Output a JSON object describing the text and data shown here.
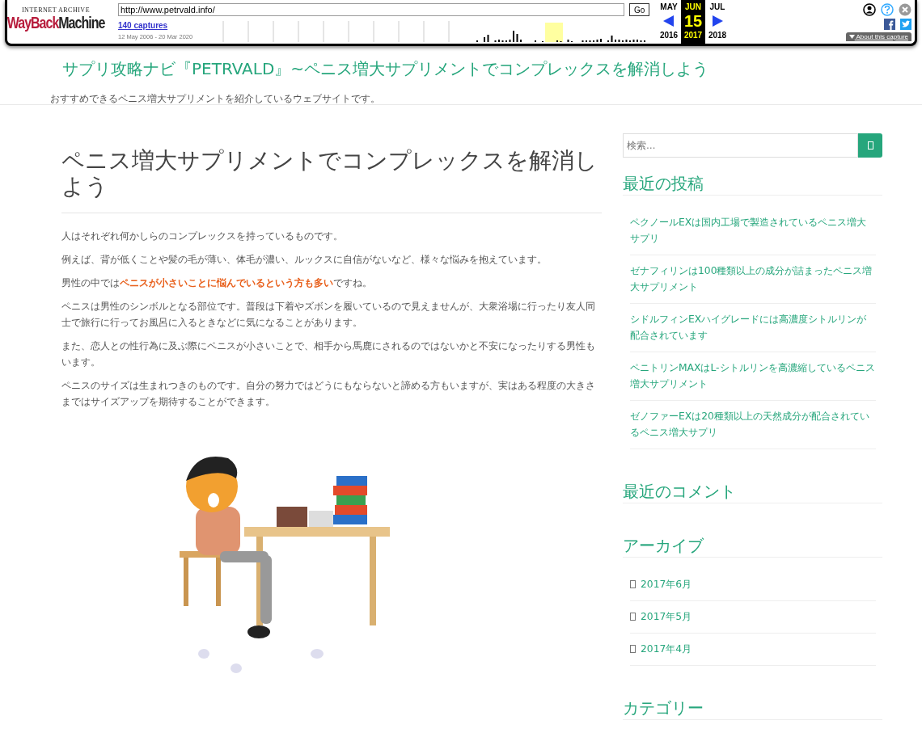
{
  "wayback": {
    "logo_top": "INTERNET ARCHIVE",
    "logo_wayback": "WayBack",
    "logo_machine": "Machine",
    "url": "http://www.petrvald.info/",
    "go_button": "Go",
    "captures_link": "140 captures",
    "date_range": "12 May 2006 - 20 Mar 2020",
    "months": [
      {
        "month": "MAY",
        "year": "2016",
        "selected": false
      },
      {
        "month": "JUN",
        "day": "15",
        "year": "2017",
        "selected": true
      },
      {
        "month": "JUL",
        "year": "2018",
        "selected": false
      }
    ],
    "about_button": "About this capture"
  },
  "site": {
    "title": "サプリ攻略ナビ『PETRVALD』~ペニス増大サプリメントでコンプレックスを解消しよう",
    "tagline": "おすすめできるペニス増大サプリメントを紹介しているウェブサイトです。"
  },
  "article": {
    "title": "ペニス増大サプリメントでコンプレックスを解消しよう",
    "paragraphs": [
      "人はそれぞれ何かしらのコンプレックスを持っているものです。",
      "例えば、背が低くことや髪の毛が薄い、体毛が濃い、ルックスに自信がないなど、様々な悩みを抱えています。",
      "男性の中では**ペニスが小さいことに悩んでいるという方も多い**ですね。",
      "ペニスは男性のシンボルとなる部位です。普段は下着やズボンを履いているので見えませんが、大衆浴場に行ったり友人同士で旅行に行ってお風呂に入るときなどに気になることがあります。",
      "また、恋人との性行為に及ぶ際にペニスが小さいことで、相手から馬鹿にされるのではないかと不安になったりする男性もいます。",
      "ペニスのサイズは生まれつきのものです。自分の努力ではどうにもならないと諦める方もいますが、実はある程度の大きさまではサイズアップを期待することができます。"
    ]
  },
  "sidebar": {
    "search": {
      "placeholder": "検索…"
    },
    "widgets": [
      {
        "title": "最近の投稿",
        "kind": "posts",
        "items": [
          "ペクノールEXは国内工場で製造されているペニス増大サプリ",
          "ゼナフィリンは100種類以上の成分が詰まったペニス増大サプリメント",
          "シドルフィンEXハイグレードには高濃度シトルリンが配合されています",
          "ペニトリンMAXはL-シトルリンを高濃縮しているペニス増大サプリメント",
          "ゼノファーEXは20種類以上の天然成分が配合されているペニス増大サプリ"
        ]
      },
      {
        "title": "最近のコメント"
      },
      {
        "title": "アーカイブ",
        "kind": "archive",
        "items": [
          "2017年6月",
          "2017年5月",
          "2017年4月"
        ]
      },
      {
        "title": "カテゴリー"
      }
    ]
  }
}
